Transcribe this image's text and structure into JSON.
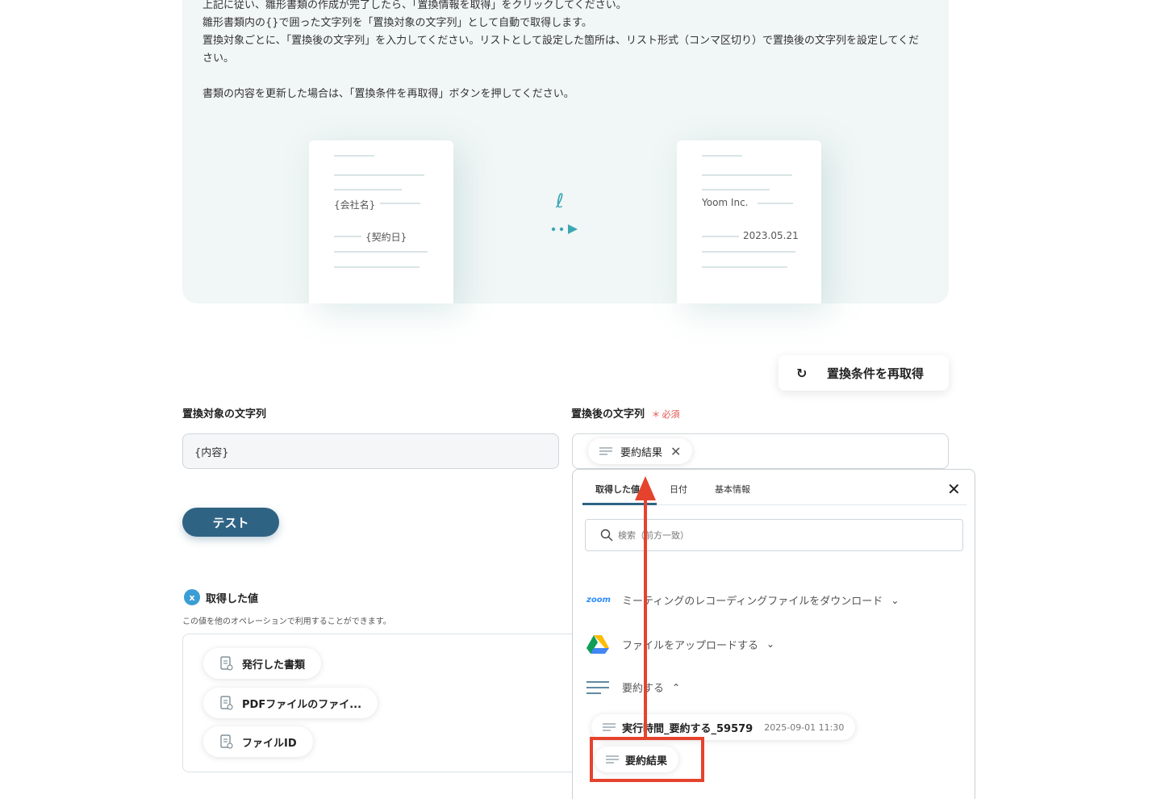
{
  "info": {
    "lines": [
      "上記に従い、雛形書類の作成が完了したら、「置換情報を取得」をクリックしてください。",
      "雛形書類内の{}で囲った文字列を「置換対象の文字列」として自動で取得します。",
      "置換対象ごとに、「置換後の文字列」を入力してください。リストとして設定した箇所は、リスト形式（コンマ区切り）で置換後の文字列を設定してください。",
      "",
      "書類の内容を更新した場合は、「置換条件を再取得」ボタンを押してください。"
    ]
  },
  "illustration": {
    "template_doc": {
      "company": "{会社名}",
      "date": "{契約日}"
    },
    "result_doc": {
      "company": "Yoom Inc.",
      "date": "2023.05.21"
    }
  },
  "refresh_button": {
    "label": "置換条件を再取得",
    "icon": "refresh-icon"
  },
  "fields": {
    "target_label": "置換対象の文字列",
    "target_value": "{内容}",
    "replace_label": "置換後の文字列",
    "required_text": "必須",
    "replace_chip": "要約結果"
  },
  "test_button": {
    "label": "テスト"
  },
  "acquired": {
    "title": "取得した値",
    "description": "この値を他のオペレーションで利用することができます。",
    "items": [
      "発行した書類",
      "PDFファイルのファイ...",
      "ファイルID"
    ]
  },
  "popup": {
    "tabs": [
      "取得した値",
      "日付",
      "基本情報"
    ],
    "search_placeholder": "検索（前方一致）",
    "sources": [
      {
        "logo": "zoom",
        "label": "ミーティングのレコーディングファイルをダウンロード",
        "icon": "zoom-icon",
        "expanded": false
      },
      {
        "label": "ファイルをアップロードする",
        "icon": "google-drive-icon",
        "expanded": false
      },
      {
        "label": "要約する",
        "icon": "summarize-icon",
        "expanded": true
      }
    ],
    "results": [
      {
        "label": "実行時間_要約する_59579",
        "timestamp": "2025-09-01 11:30"
      },
      {
        "label": "要約結果"
      }
    ]
  },
  "colors": {
    "accent": "#2f6384",
    "highlight": "#e5432d",
    "required": "#e5534b",
    "zoom": "#2d8cff"
  }
}
